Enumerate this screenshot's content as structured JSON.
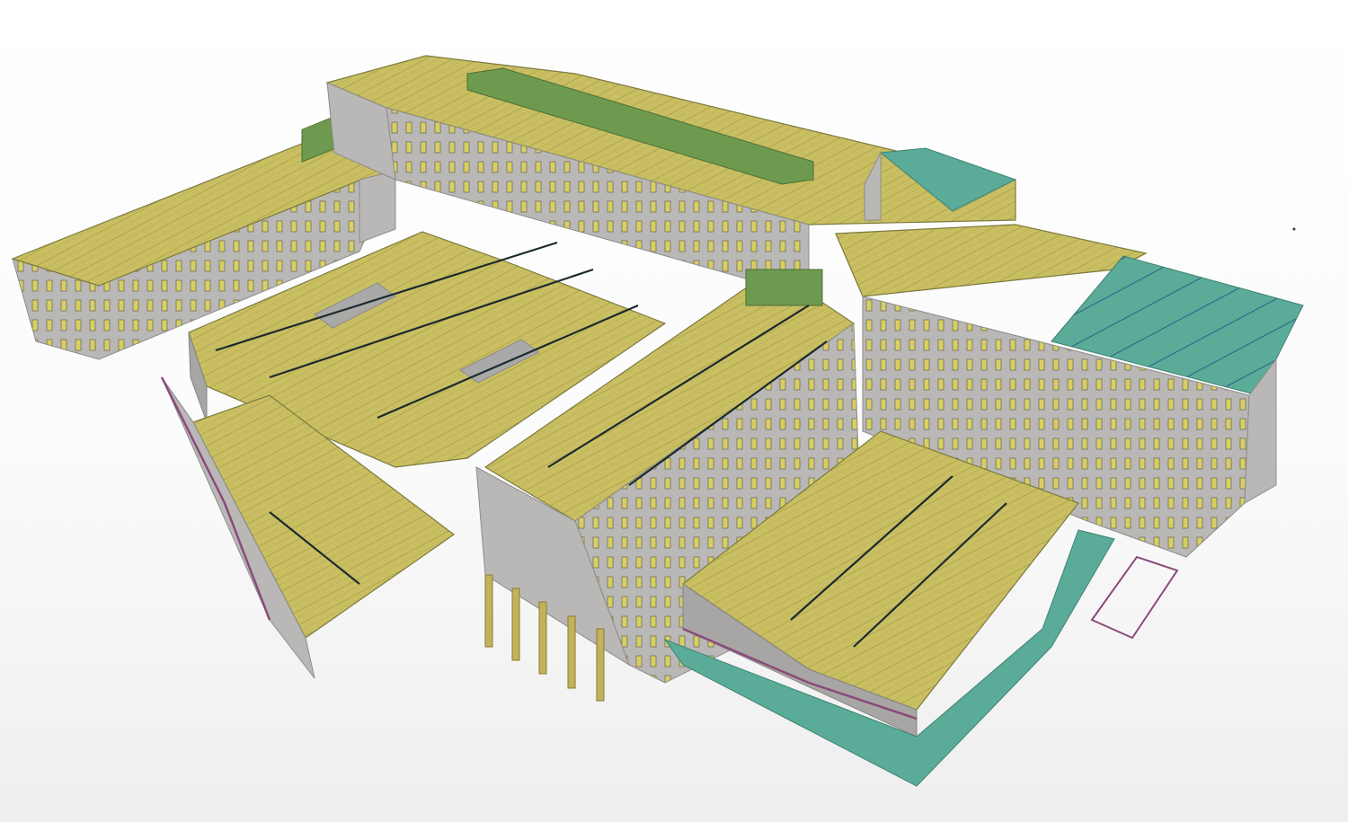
{
  "colors": {
    "roof": "#c9bf62",
    "wall": "#b9b8b6",
    "slab": "#5aab98",
    "steel": "#8a4b7a",
    "beam": "#1c2a2e",
    "box": "#6d9a4f"
  }
}
